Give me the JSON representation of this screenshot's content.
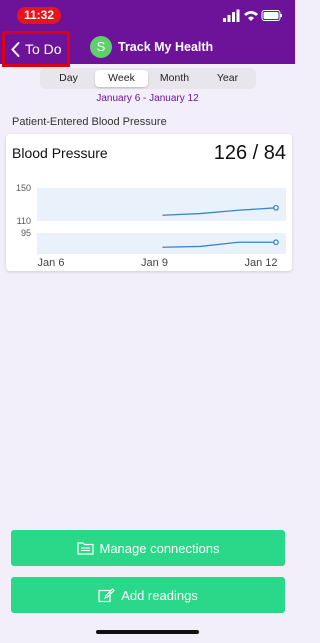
{
  "status_bar": {
    "time": "11:32"
  },
  "nav": {
    "back_label": "To Do",
    "avatar_letter": "S",
    "title": "Track My Health"
  },
  "range_tabs": [
    "Day",
    "Week",
    "Month",
    "Year"
  ],
  "selected_tab": "Week",
  "date_range": "January 6 - January 12",
  "section_label": "Patient-Entered Blood Pressure",
  "card": {
    "title": "Blood Pressure",
    "value": "126 / 84"
  },
  "chart_data": {
    "type": "line",
    "x": [
      "Jan 6",
      "Jan 9",
      "Jan 12"
    ],
    "y_ticks": [
      "150",
      "110",
      "95"
    ],
    "bands": [
      [
        110,
        150
      ],
      [
        70,
        95
      ]
    ],
    "series": [
      {
        "values": [
          [
            9,
            117
          ],
          [
            10,
            119
          ],
          [
            11,
            123
          ],
          [
            12,
            126
          ]
        ]
      },
      {
        "values": [
          [
            9,
            78
          ],
          [
            10,
            79
          ],
          [
            11,
            84
          ],
          [
            12,
            84
          ]
        ]
      }
    ],
    "colors": {
      "line": "#3a86c8",
      "band": "#e9f1fb"
    }
  },
  "buttons": {
    "manage": "Manage connections",
    "add": "Add readings"
  }
}
